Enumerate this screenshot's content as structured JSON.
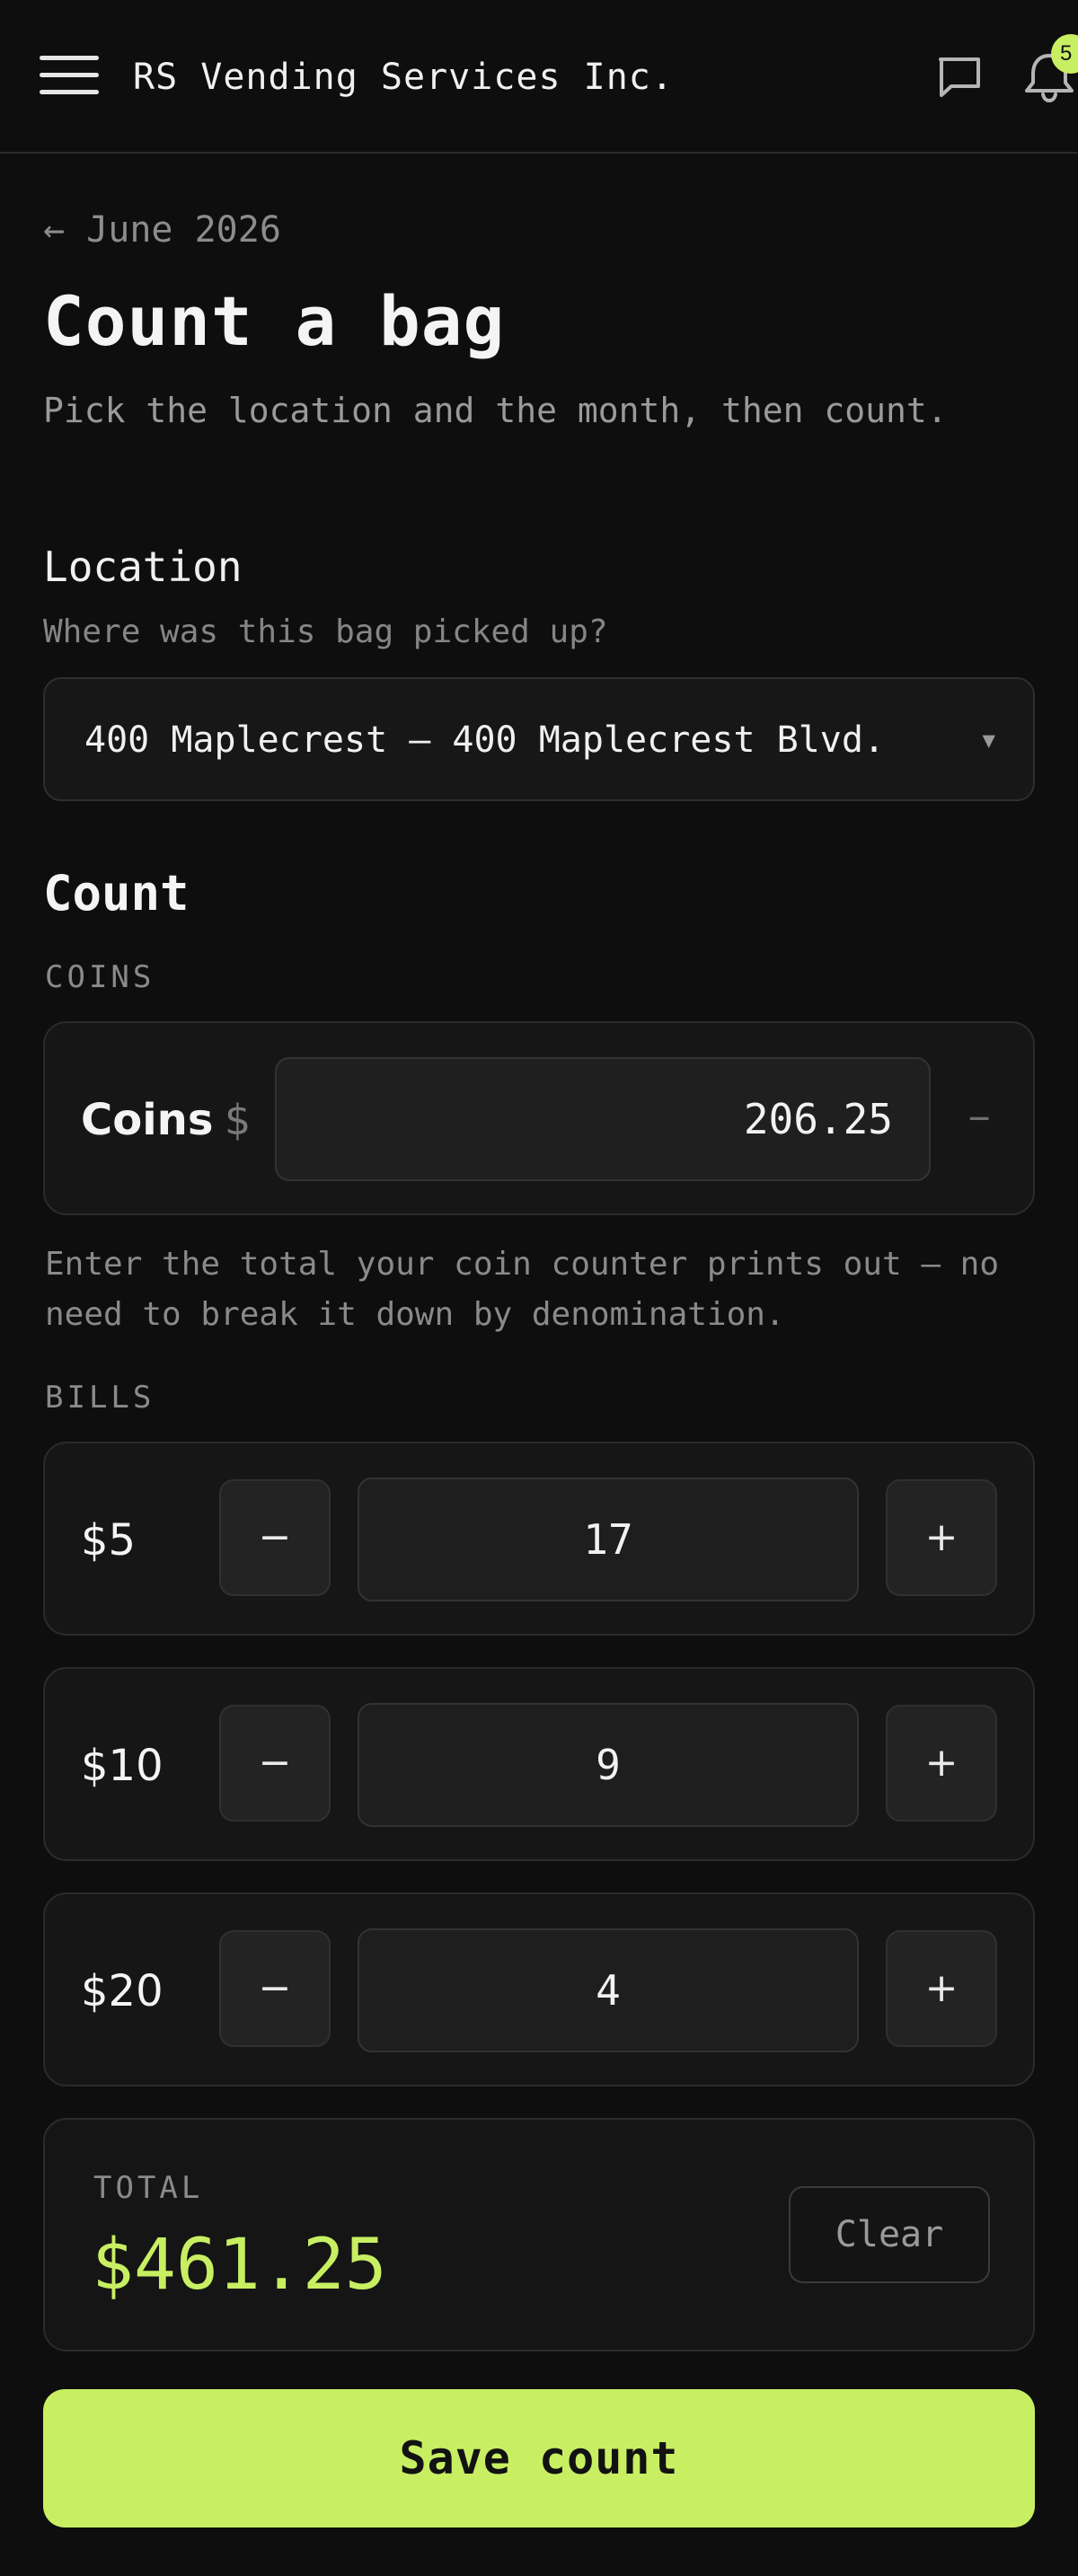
{
  "app": {
    "company_name": "RS Vending Services Inc.",
    "notification_count": "5",
    "icons": {
      "menu": "hamburger-menu-icon",
      "chat": "chat-bubble-icon",
      "notifications": "bell-icon"
    }
  },
  "header": {
    "back_link": "← June 2026",
    "title": "Count a bag",
    "subtitle": "Pick the location and the month, then count."
  },
  "location": {
    "label": "Location",
    "hint": "Where was this bag picked up?",
    "selected": "400 Maplecrest — 400 Maplecrest Blvd.",
    "caret": "▼"
  },
  "count": {
    "heading": "Count",
    "coins": {
      "section_label": "COINS",
      "label": "Coins",
      "currency": "$",
      "value": "206.25",
      "clear_symbol": "−",
      "help": "Enter the total your coin counter prints out — no need to break it down by denomination."
    },
    "bills": {
      "section_label": "BILLS",
      "items": [
        {
          "label": "$5",
          "quantity": "17",
          "minus": "−",
          "plus": "+"
        },
        {
          "label": "$10",
          "quantity": "9",
          "minus": "−",
          "plus": "+"
        },
        {
          "label": "$20",
          "quantity": "4",
          "minus": "−",
          "plus": "+"
        }
      ]
    }
  },
  "total": {
    "label": "TOTAL",
    "value": "$461.25",
    "clear_label": "Clear"
  },
  "actions": {
    "save_label": "Save count"
  },
  "colors": {
    "background": "#0e0e0e",
    "accent": "#c8ef62",
    "card": "#161616",
    "muted_text": "#8a8a8a"
  }
}
